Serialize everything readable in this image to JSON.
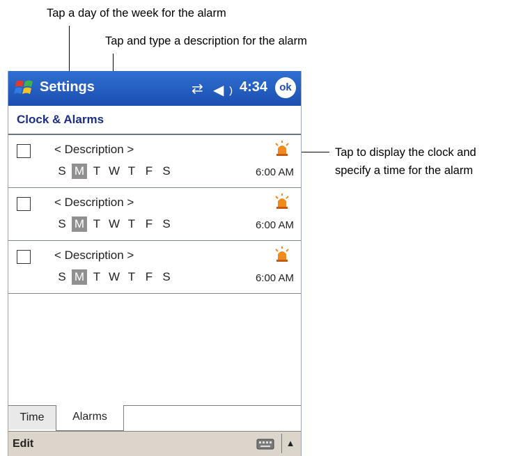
{
  "annotations": {
    "day_callout": "Tap a day of the week for the alarm",
    "description_callout": "Tap and type a description for the alarm",
    "clock_callout_line1": "Tap to display the clock and",
    "clock_callout_line2": "specify a time for the alarm"
  },
  "titlebar": {
    "title": "Settings",
    "time": "4:34",
    "ok_label": "ok",
    "icons": [
      "start-flag-icon",
      "connectivity-icon",
      "volume-icon"
    ]
  },
  "page": {
    "title": "Clock & Alarms"
  },
  "alarms": [
    {
      "checked": false,
      "description": "< Description >",
      "days": [
        "S",
        "M",
        "T",
        "W",
        "T",
        "F",
        "S"
      ],
      "active_day": "M",
      "time": "6:00 AM",
      "icon": "alarm-bell-icon"
    },
    {
      "checked": false,
      "description": "< Description >",
      "days": [
        "S",
        "M",
        "T",
        "W",
        "T",
        "F",
        "S"
      ],
      "active_day": "M",
      "time": "6:00 AM",
      "icon": "alarm-bell-icon"
    },
    {
      "checked": false,
      "description": "< Description >",
      "days": [
        "S",
        "M",
        "T",
        "W",
        "T",
        "F",
        "S"
      ],
      "active_day": "M",
      "time": "6:00 AM",
      "icon": "alarm-bell-icon"
    }
  ],
  "tabs": [
    {
      "label": "Time",
      "selected": false
    },
    {
      "label": "Alarms",
      "selected": true
    }
  ],
  "menubar": {
    "edit_label": "Edit",
    "keyboard_icon": "keyboard-icon",
    "sip_arrow": "▲"
  },
  "colors": {
    "titlebar": "#1b4fb0",
    "page_title": "#1a2e8a",
    "active_day_bg": "#909090",
    "menubar": "#dcd5cc"
  }
}
